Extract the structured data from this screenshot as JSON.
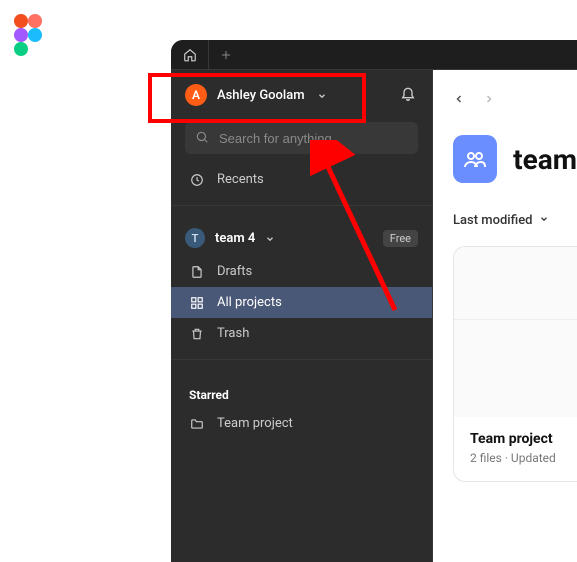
{
  "user": {
    "avatar_letter": "A",
    "name": "Ashley Goolam"
  },
  "search": {
    "placeholder": "Search for anything"
  },
  "sidebar": {
    "recents": "Recents",
    "team_avatar": "T",
    "team_name": "team 4",
    "free_label": "Free",
    "drafts": "Drafts",
    "all_projects": "All projects",
    "trash": "Trash",
    "starred_header": "Starred",
    "team_project": "Team project"
  },
  "content": {
    "page_title": "team",
    "filter_label": "Last modified",
    "card_title": "Team project",
    "card_sub": "2 files · Updated"
  }
}
